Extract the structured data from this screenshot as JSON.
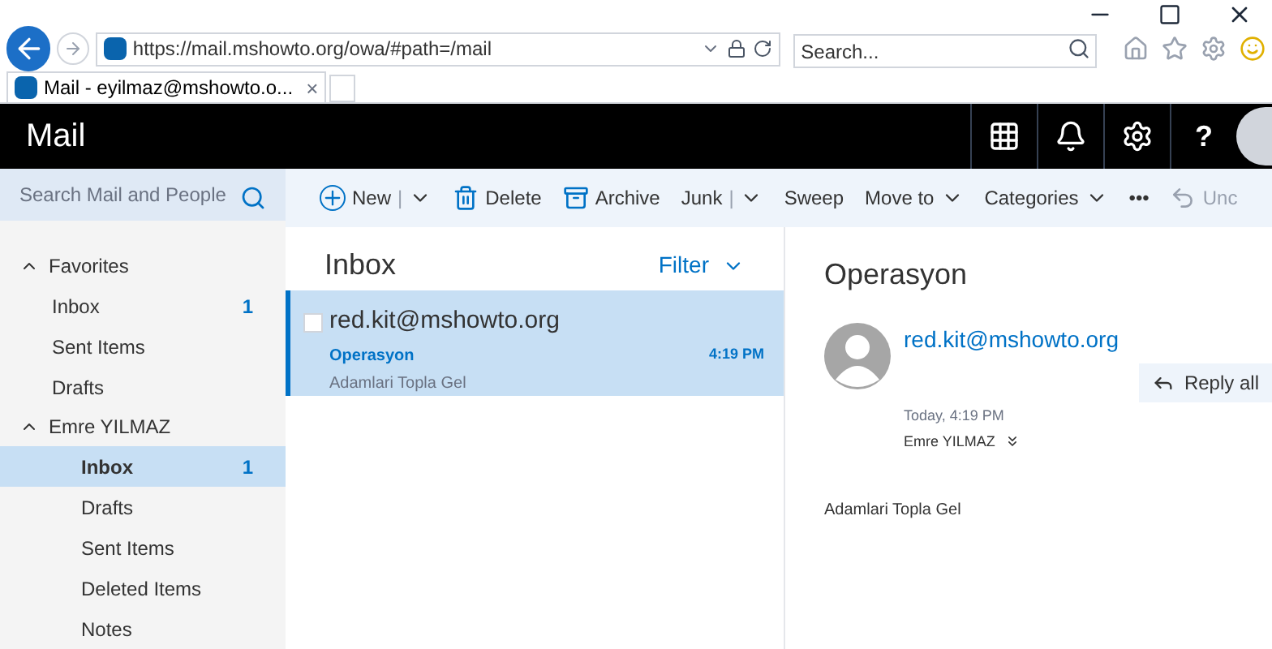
{
  "browser": {
    "url": "https://mail.mshowto.org/owa/#path=/mail",
    "search_placeholder": "Search...",
    "tab": {
      "title": "Mail - eyilmaz@mshowto.o...",
      "close": "×"
    }
  },
  "header": {
    "title": "Mail",
    "help": "?"
  },
  "search": {
    "placeholder": "Search Mail and People"
  },
  "toolbar": [
    {
      "kind": "add-split",
      "label": "New",
      "separator": "|",
      "disabled": false
    },
    {
      "kind": "delete",
      "label": "Delete",
      "disabled": false
    },
    {
      "kind": "archive",
      "label": "Archive",
      "disabled": false
    },
    {
      "kind": "split",
      "label": "Junk",
      "separator": "|",
      "disabled": false
    },
    {
      "kind": "plain",
      "label": "Sweep",
      "disabled": false
    },
    {
      "kind": "dropdown",
      "label": "Move to",
      "disabled": false
    },
    {
      "kind": "dropdown",
      "label": "Categories",
      "disabled": false
    },
    {
      "kind": "plain",
      "label": "•••",
      "disabled": false
    },
    {
      "kind": "undo",
      "label": "Unc",
      "disabled": true
    }
  ],
  "folders": [
    {
      "label": "Favorites",
      "expanded": true,
      "children": [
        {
          "label": "Inbox",
          "count": "1",
          "selected": false
        },
        {
          "label": "Sent Items",
          "selected": false
        },
        {
          "label": "Drafts",
          "selected": false
        }
      ]
    },
    {
      "label": "Emre YILMAZ",
      "expanded": true,
      "children": [
        {
          "label": "Inbox",
          "count": "1",
          "selected": true
        },
        {
          "label": "Drafts",
          "selected": false
        },
        {
          "label": "Sent Items",
          "selected": false
        },
        {
          "label": "Deleted Items",
          "selected": false
        },
        {
          "label": "Notes",
          "selected": false
        }
      ]
    }
  ],
  "message_list": {
    "title": "Inbox",
    "filter": "Filter",
    "messages": [
      {
        "sender": "red.kit@mshowto.org",
        "subject": "Operasyon",
        "time": "4:19 PM",
        "preview": "Adamlari Topla Gel",
        "selected": true,
        "checked": false
      }
    ]
  },
  "reading_pane": {
    "subject": "Operasyon",
    "from": "red.kit@mshowto.org",
    "reply": "Reply all",
    "date": "Today, 4:19 PM",
    "to": "Emre YILMAZ",
    "body": "Adamlari Topla Gel"
  }
}
